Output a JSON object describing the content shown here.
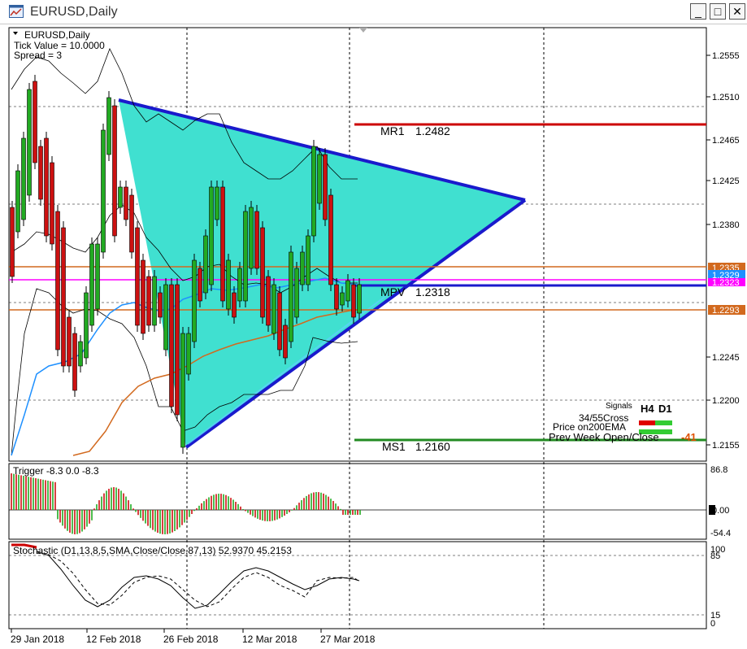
{
  "window": {
    "title": "EURUSD,Daily",
    "minimize": "_",
    "maximize": "□",
    "close": "✕"
  },
  "info": {
    "symbol": "EURUSD,Daily",
    "tick_value": "Tick Value = 10.0000",
    "spread": "Spread = 3"
  },
  "levels": {
    "mr1_name": "MR1",
    "mr1_value": "1.2482",
    "mpv_name": "MPV",
    "mpv_value": "1.2318",
    "ms1_name": "MS1",
    "ms1_value": "1.2160"
  },
  "badges": [
    {
      "text": "1.2335",
      "color": "#d2691e"
    },
    {
      "text": "1.2329",
      "color": "#1e90ff"
    },
    {
      "text": "1.2323",
      "color": "#ff00ff"
    },
    {
      "text": "1.2293",
      "color": "#d2691e"
    }
  ],
  "signals": {
    "header": "Signals",
    "col_h4": "H4",
    "col_d1": "D1",
    "rows": [
      {
        "label": "34/55Cross",
        "h4": "#e00000",
        "d1": "#33cc33"
      },
      {
        "label": "Price on200EMA",
        "h4": "#33cc33",
        "d1": "#33cc33"
      },
      {
        "label": "Prev Week Open/Close",
        "value": "-41"
      }
    ]
  },
  "price_axis": [
    "1.2555",
    "1.2510",
    "1.2465",
    "1.2425",
    "1.2380",
    "1.2245",
    "1.2200",
    "1.2155"
  ],
  "trigger": {
    "label": "Trigger -8.3 0.0 -8.3",
    "axis_top": "86.8",
    "axis_zero": "0.00",
    "axis_bottom": "-54.4"
  },
  "stochastic": {
    "label": "Stochastic (D1,13,8,5,SMA,Close/Close,87,13) 52.9370 45.2153",
    "axis": [
      "100",
      "85",
      "15",
      "0"
    ]
  },
  "time_axis": [
    "29 Jan 2018",
    "12 Feb 2018",
    "26 Feb 2018",
    "12 Mar 2018",
    "27 Mar 2018"
  ],
  "colors": {
    "triangle_fill": "#40e0d0",
    "triangle_line": "#1a1acc",
    "bull": "#22aa22",
    "bear": "#cc1111",
    "mr1": "#cc0000",
    "ms1": "#228b22"
  }
}
